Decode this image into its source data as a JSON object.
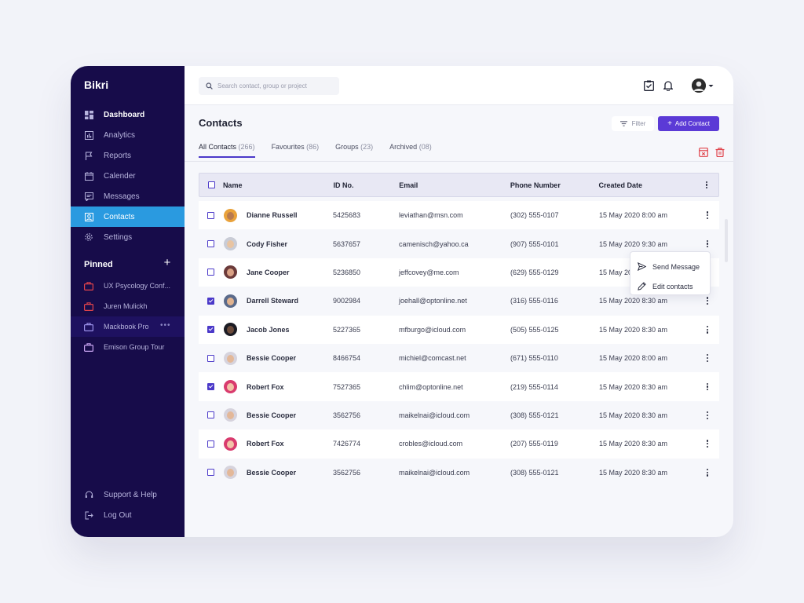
{
  "app": {
    "name": "Bikri"
  },
  "sidebar": {
    "nav": [
      {
        "label": "Dashboard",
        "icon": "dashboard-icon"
      },
      {
        "label": "Analytics",
        "icon": "analytics-icon"
      },
      {
        "label": "Reports",
        "icon": "flag-icon"
      },
      {
        "label": "Calender",
        "icon": "calendar-icon"
      },
      {
        "label": "Messages",
        "icon": "messages-icon"
      },
      {
        "label": "Contacts",
        "icon": "contacts-icon"
      },
      {
        "label": "Settings",
        "icon": "gear-icon"
      }
    ],
    "pinned_title": "Pinned",
    "pinned": [
      {
        "label": "UX Psycology Conf..."
      },
      {
        "label": "Juren Mulickh"
      },
      {
        "label": "Mackbook Pro"
      },
      {
        "label": "Emison Group Tour"
      }
    ],
    "bottom": [
      {
        "label": "Support & Help",
        "icon": "support-icon"
      },
      {
        "label": "Log Out",
        "icon": "logout-icon"
      }
    ]
  },
  "topbar": {
    "search_placeholder": "Search contact, group or project"
  },
  "page": {
    "title": "Contacts",
    "filter_label": "Filter",
    "add_label": "Add Contact",
    "tabs": [
      {
        "label": "All Contacts",
        "count": "(266)"
      },
      {
        "label": "Favourites",
        "count": "(86)"
      },
      {
        "label": "Groups",
        "count": "(23)"
      },
      {
        "label": "Archived",
        "count": "(08)"
      }
    ]
  },
  "table": {
    "headers": {
      "name": "Name",
      "id": "ID No.",
      "email": "Email",
      "phone": "Phone Number",
      "date": "Created Date"
    },
    "rows": [
      {
        "name": "Dianne Russell",
        "id": "5425683",
        "email": "leviathan@msn.com",
        "phone": "(302) 555-0107",
        "date": "15 May 2020 8:00 am",
        "checked": false
      },
      {
        "name": "Cody Fisher",
        "id": "5637657",
        "email": "camenisch@yahoo.ca",
        "phone": "(907) 555-0101",
        "date": "15 May 2020 9:30 am",
        "checked": false
      },
      {
        "name": "Jane Cooper",
        "id": "5236850",
        "email": "jeffcovey@me.com",
        "phone": "(629) 555-0129",
        "date": "15 May 2020 8:00 am",
        "checked": false
      },
      {
        "name": "Darrell Steward",
        "id": "9002984",
        "email": "joehall@optonline.net",
        "phone": "(316) 555-0116",
        "date": "15 May 2020 8:30 am",
        "checked": true
      },
      {
        "name": "Jacob Jones",
        "id": "5227365",
        "email": "mfburgo@icloud.com",
        "phone": "(505) 555-0125",
        "date": "15 May 2020 8:30 am",
        "checked": true
      },
      {
        "name": "Bessie Cooper",
        "id": "8466754",
        "email": "michiel@comcast.net",
        "phone": "(671) 555-0110",
        "date": "15 May 2020 8:00 am",
        "checked": false
      },
      {
        "name": "Robert Fox",
        "id": "7527365",
        "email": "chlim@optonline.net",
        "phone": "(219) 555-0114",
        "date": "15 May 2020 8:30 am",
        "checked": true
      },
      {
        "name": "Bessie Cooper",
        "id": "3562756",
        "email": "maikelnai@icloud.com",
        "phone": "(308) 555-0121",
        "date": "15 May 2020 8:30 am",
        "checked": false
      },
      {
        "name": "Robert Fox",
        "id": "7426774",
        "email": "crobles@icloud.com",
        "phone": "(207) 555-0119",
        "date": "15 May 2020 8:30 am",
        "checked": false
      },
      {
        "name": "Bessie Cooper",
        "id": "3562756",
        "email": "maikelnai@icloud.com",
        "phone": "(308) 555-0121",
        "date": "15 May 2020 8:30 am",
        "checked": false
      }
    ]
  },
  "dropdown": {
    "items": [
      {
        "label": "Send Message",
        "icon": "send-icon"
      },
      {
        "label": "Edit contacts",
        "icon": "pencil-icon"
      }
    ]
  },
  "colors": {
    "sidebar_bg": "#170c4a",
    "active_nav": "#2a9ae0",
    "accent": "#5b3ad6",
    "danger": "#e0434b"
  }
}
